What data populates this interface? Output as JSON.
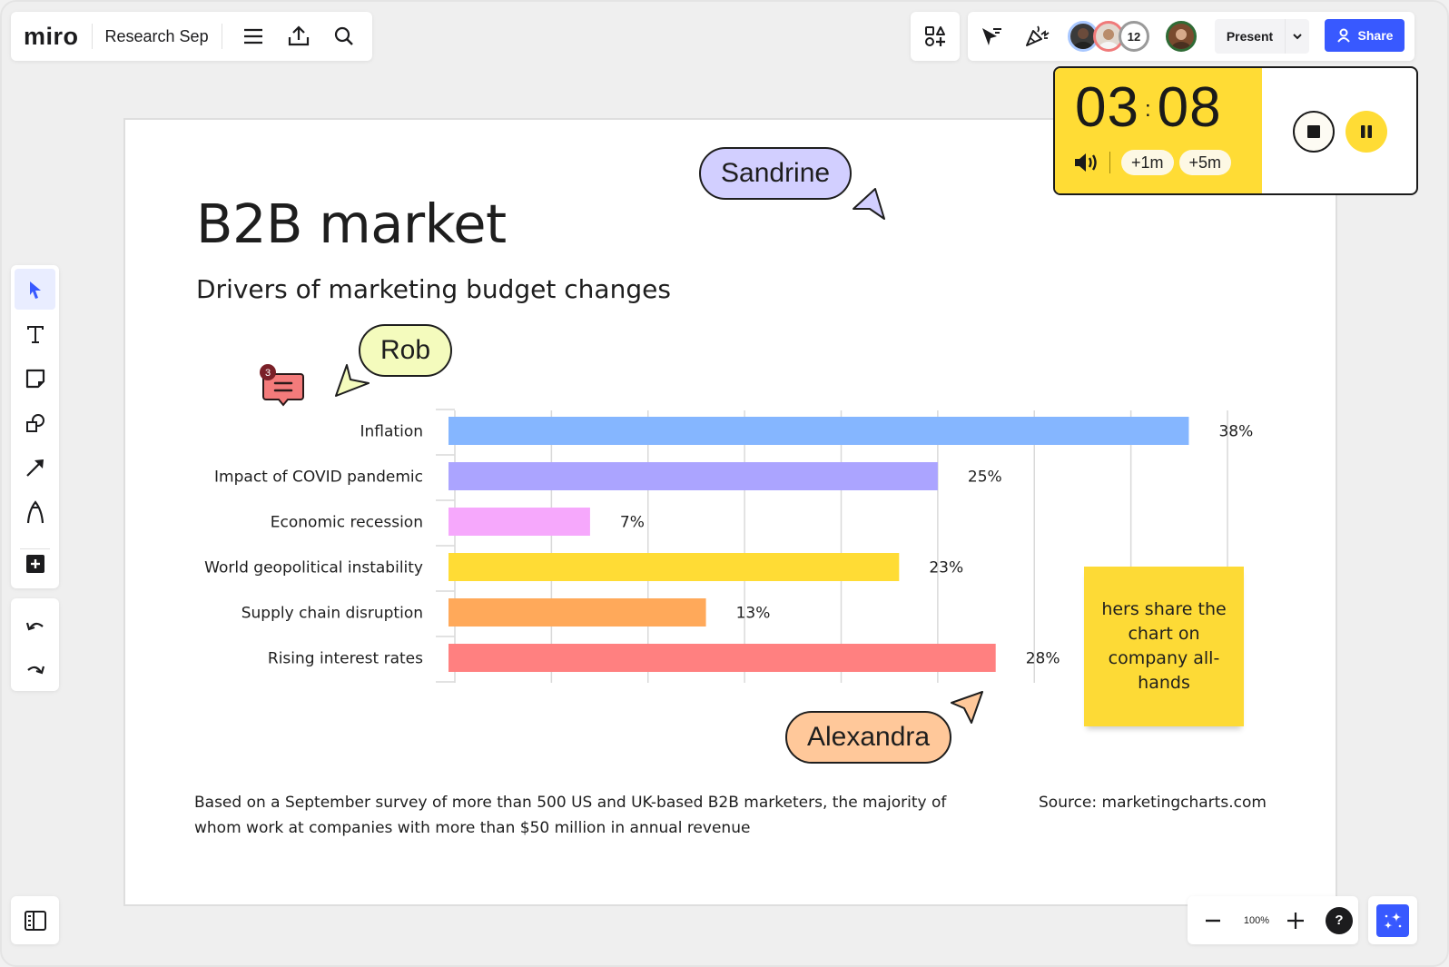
{
  "app": {
    "logo": "miro",
    "board_name": "Research Sep"
  },
  "toolbar_top_left": {
    "icons": [
      "menu-icon",
      "export-icon",
      "search-icon"
    ]
  },
  "collaboration": {
    "avatars": [
      {
        "name": "collaborator-1",
        "ring_color": "#a9c8ff",
        "bg": "#3a3a3a"
      },
      {
        "name": "collaborator-2",
        "ring_color": "#f07a7a",
        "bg": "#d9c9bb"
      }
    ],
    "extra_count": "12",
    "self_avatar": {
      "ring_color": "#2f6b35",
      "bg": "#7a4a2e"
    },
    "present_label": "Present",
    "share_label": "Share"
  },
  "timer": {
    "minutes": "03",
    "seconds": "08",
    "add_one_label": "+1m",
    "add_five_label": "+5m"
  },
  "frame": {
    "title": "B2B market",
    "subtitle": "Drivers of marketing budget changes",
    "footnote": "Based on a September survey of more than 500 US and UK-based B2B marketers, the majority of whom work at companies with more than $50 million in annual revenue",
    "source": "Source: marketingcharts.com"
  },
  "chart_data": {
    "type": "bar",
    "orientation": "horizontal",
    "title": "Drivers of marketing budget changes",
    "categories": [
      "Inflation",
      "Impact of COVID pandemic",
      "Economic recession",
      "World geopolitical instability",
      "Supply chain disruption",
      "Rising interest rates"
    ],
    "values": [
      38,
      25,
      7,
      23,
      13,
      28
    ],
    "data_labels": [
      "38%",
      "25%",
      "7%",
      "23%",
      "13%",
      "28%"
    ],
    "colors": [
      "#85b6ff",
      "#aba4ff",
      "#f6a8fc",
      "#ffdc35",
      "#ffa95a",
      "#ff8080"
    ],
    "xlim": [
      0,
      40
    ],
    "grid_step": 5,
    "grid": true,
    "xlabel": "",
    "ylabel": ""
  },
  "sticky_note": {
    "text": "hers share the chart on company all-hands",
    "color": "#fdda36"
  },
  "cursors": [
    {
      "name": "Sandrine",
      "color": "#d2cfff"
    },
    {
      "name": "Rob",
      "color": "#f4fbbd"
    },
    {
      "name": "Alexandra",
      "color": "#ffc89a"
    }
  ],
  "comment": {
    "count": "3",
    "color": "#f47b7b"
  },
  "zoom": {
    "level": "100%",
    "help_label": "?"
  }
}
